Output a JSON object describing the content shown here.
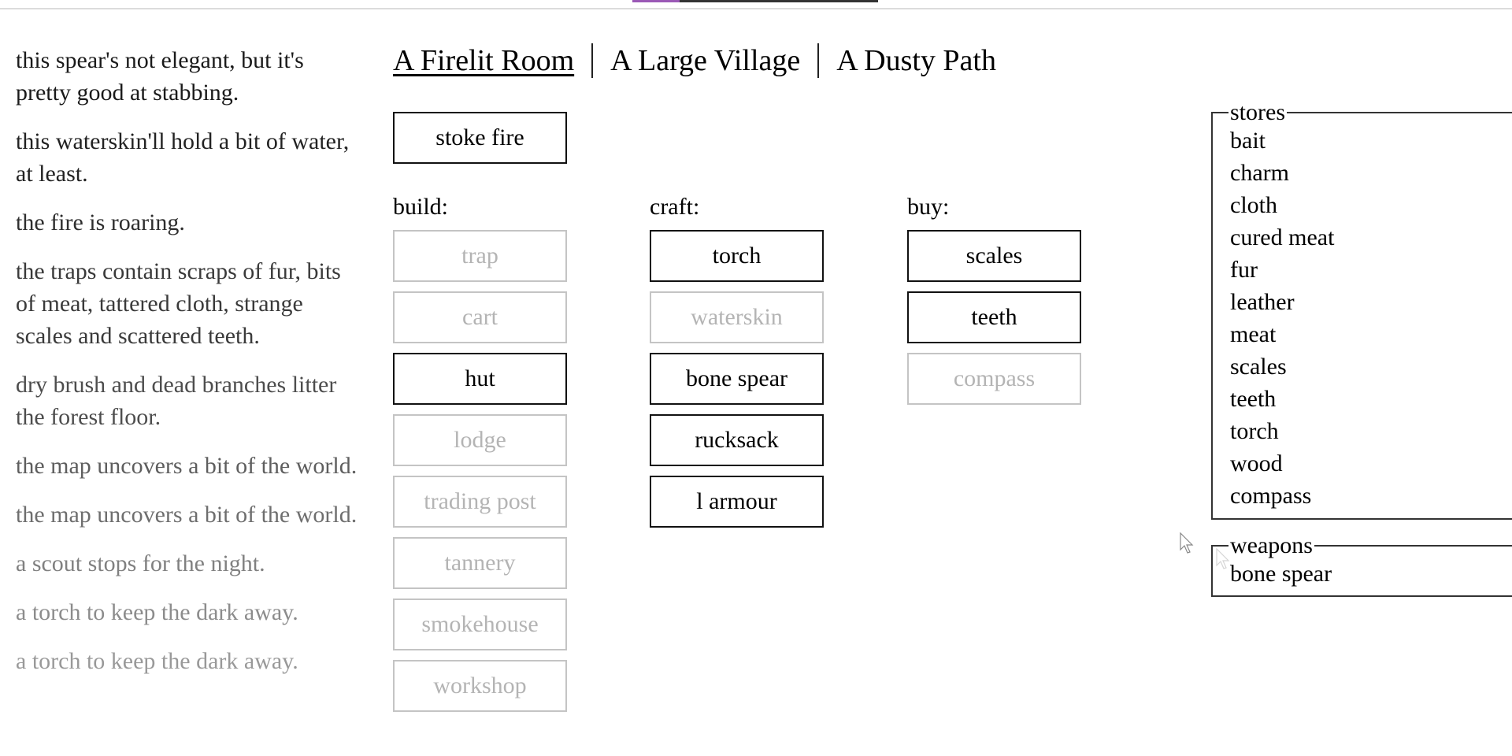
{
  "notifications": [
    {
      "text": "this spear's not elegant, but it's pretty good at stabbing.",
      "color": "#1a1a1a"
    },
    {
      "text": "this waterskin'll hold a bit of water, at least.",
      "color": "#222222"
    },
    {
      "text": "the fire is roaring.",
      "color": "#2e2e2e"
    },
    {
      "text": "the traps contain scraps of fur, bits of meat, tattered cloth, strange scales and scattered teeth.",
      "color": "#3a3a3a"
    },
    {
      "text": "dry brush and dead branches litter the forest floor.",
      "color": "#4d4d4d"
    },
    {
      "text": "the map uncovers a bit of the world.",
      "color": "#5e5e5e"
    },
    {
      "text": "the map uncovers a bit of the world.",
      "color": "#6e6e6e"
    },
    {
      "text": "a scout stops for the night.",
      "color": "#808080"
    },
    {
      "text": "a torch to keep the dark away.",
      "color": "#8c8c8c"
    },
    {
      "text": "a torch to keep the dark away.",
      "color": "#999999"
    }
  ],
  "header": {
    "tabs": [
      {
        "label": "A Firelit Room",
        "selected": true
      },
      {
        "label": "A Large Village",
        "selected": false
      },
      {
        "label": "A Dusty Path",
        "selected": false
      }
    ]
  },
  "room": {
    "stoke_fire": "stoke fire",
    "build_label": "build:",
    "craft_label": "craft:",
    "buy_label": "buy:",
    "build": [
      {
        "label": "trap",
        "enabled": false
      },
      {
        "label": "cart",
        "enabled": false
      },
      {
        "label": "hut",
        "enabled": true
      },
      {
        "label": "lodge",
        "enabled": false
      },
      {
        "label": "trading post",
        "enabled": false
      },
      {
        "label": "tannery",
        "enabled": false
      },
      {
        "label": "smokehouse",
        "enabled": false
      },
      {
        "label": "workshop",
        "enabled": false
      }
    ],
    "craft": [
      {
        "label": "torch",
        "enabled": true
      },
      {
        "label": "waterskin",
        "enabled": false
      },
      {
        "label": "bone spear",
        "enabled": true
      },
      {
        "label": "rucksack",
        "enabled": true
      },
      {
        "label": "l armour",
        "enabled": true
      }
    ],
    "buy": [
      {
        "label": "scales",
        "enabled": true
      },
      {
        "label": "teeth",
        "enabled": true
      },
      {
        "label": "compass",
        "enabled": false
      }
    ]
  },
  "stores": {
    "legend": "stores",
    "items": [
      "bait",
      "charm",
      "cloth",
      "cured meat",
      "fur",
      "leather",
      "meat",
      "scales",
      "teeth",
      "torch",
      "wood",
      "compass"
    ]
  },
  "weapons": {
    "legend": "weapons",
    "items": [
      "bone spear"
    ]
  },
  "colors": {
    "enabled_border": "#111111",
    "disabled_border": "#c4c4c4",
    "disabled_text": "#b4b4b4",
    "tab_accent": "#9b59b6"
  }
}
